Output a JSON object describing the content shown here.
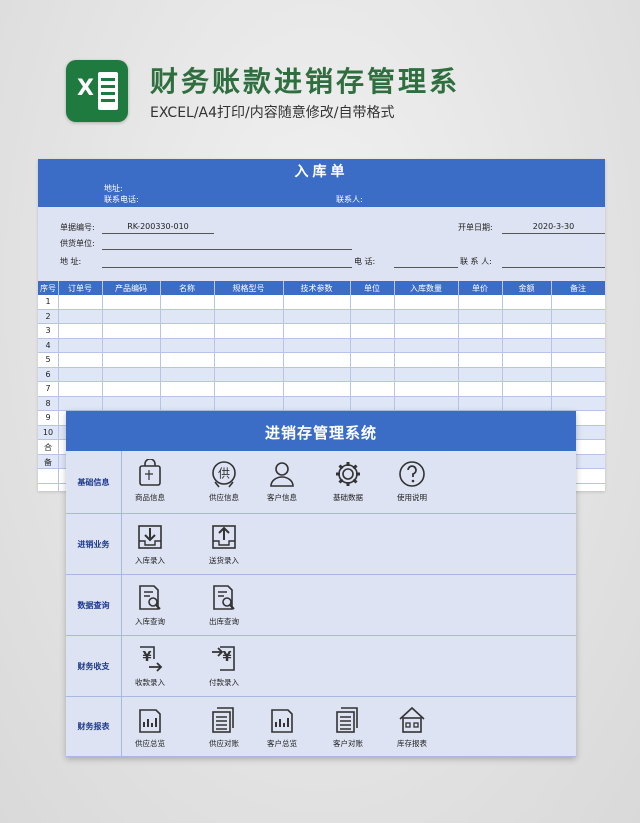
{
  "header": {
    "title": "财务账款进销存管理系",
    "subtitle": "EXCEL/A4打印/内容随意修改/自带格式",
    "logo_letter": "X"
  },
  "colors": {
    "accent": "#3b6cc6",
    "light": "#dde3f3",
    "green": "#1f7a3f"
  },
  "sheet": {
    "title": "入库单",
    "address_label": "地址:",
    "phone_label": "联系电话:",
    "contact_label": "联系人:",
    "order_no_label": "单据编号:",
    "order_no": "RK-200330-010",
    "date_label": "开单日期:",
    "date": "2020-3-30",
    "supplier_label": "供货单位:",
    "addr2_label": "地    址:",
    "tel_label": "电    话:",
    "contact2_label": "联 系 人:",
    "columns": [
      "序号",
      "订单号",
      "产品编码",
      "名称",
      "规格型号",
      "技术参数",
      "单位",
      "入库数量",
      "单价",
      "金额",
      "备注"
    ],
    "rows": [
      "1",
      "2",
      "3",
      "4",
      "5",
      "6",
      "7",
      "8",
      "9",
      "10"
    ],
    "footer_rows": [
      "合",
      "备"
    ]
  },
  "panel": {
    "title": "进销存管理系统",
    "sections": [
      {
        "label": "基础信息",
        "items": [
          {
            "label": "商品信息",
            "icon": "bag-icon"
          },
          {
            "label": "供应信息",
            "icon": "supply-icon"
          },
          {
            "label": "客户信息",
            "icon": "user-icon"
          },
          {
            "label": "基础数据",
            "icon": "gear-icon"
          },
          {
            "label": "使用说明",
            "icon": "question-icon"
          }
        ]
      },
      {
        "label": "进销业务",
        "items": [
          {
            "label": "入库录入",
            "icon": "inbox-in-icon"
          },
          {
            "label": "送货录入",
            "icon": "inbox-out-icon"
          }
        ]
      },
      {
        "label": "数据查询",
        "items": [
          {
            "label": "入库查询",
            "icon": "doc-search-icon"
          },
          {
            "label": "出库查询",
            "icon": "doc-search-icon"
          }
        ]
      },
      {
        "label": "财务收支",
        "items": [
          {
            "label": "收款录入",
            "icon": "yen-in-icon"
          },
          {
            "label": "付款录入",
            "icon": "yen-out-icon"
          }
        ]
      },
      {
        "label": "财务报表",
        "items": [
          {
            "label": "供应总览",
            "icon": "chart-doc-icon"
          },
          {
            "label": "供应对账",
            "icon": "docs-icon"
          },
          {
            "label": "客户总览",
            "icon": "chart-doc-icon"
          },
          {
            "label": "客户对账",
            "icon": "docs-icon"
          },
          {
            "label": "库存报表",
            "icon": "house-icon"
          }
        ]
      }
    ]
  }
}
